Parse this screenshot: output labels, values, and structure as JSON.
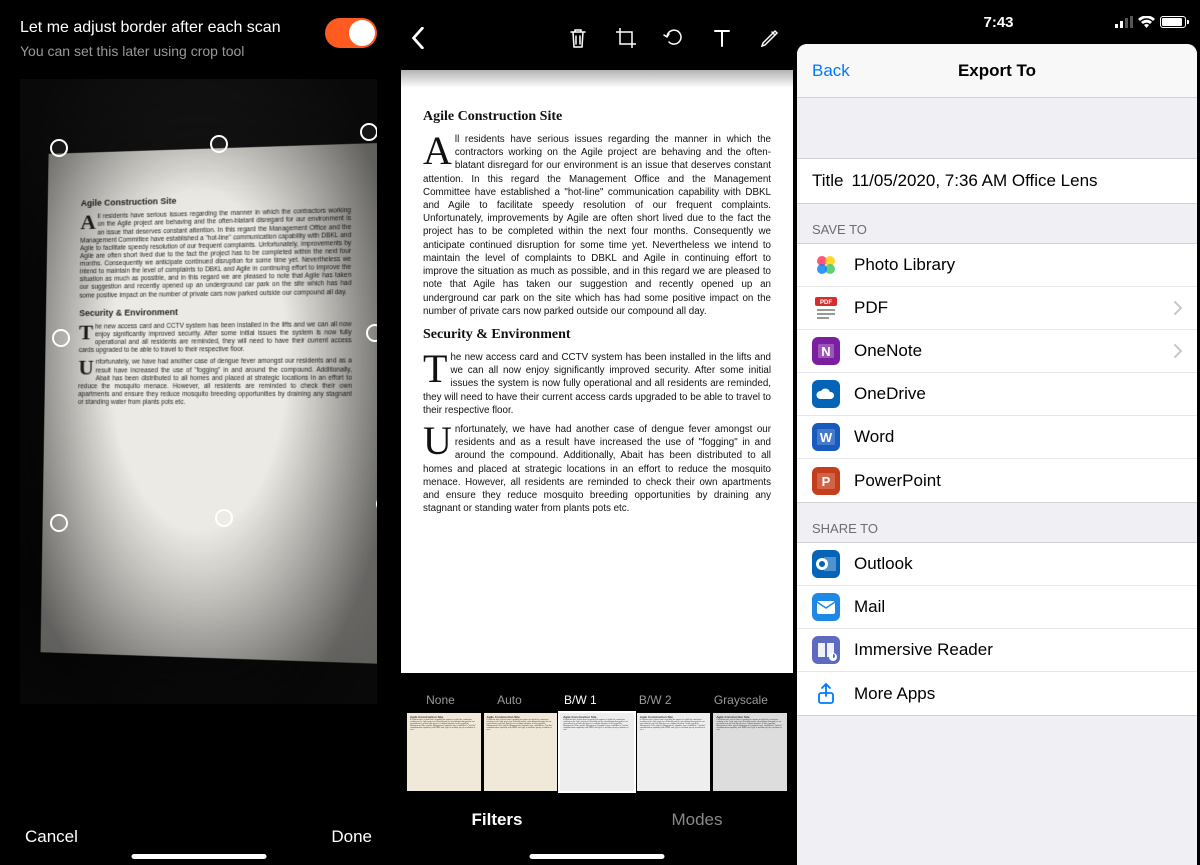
{
  "status_bar": {
    "time": "7:43"
  },
  "panel1": {
    "title": "Let me adjust border after each scan",
    "subtitle": "You can set this later using crop tool",
    "toggle_on": true,
    "cancel": "Cancel",
    "done": "Done"
  },
  "document": {
    "h1": "Agile Construction Site",
    "p1_cap": "A",
    "p1": "ll residents have serious issues regarding the manner in which the contractors working on the Agile project are behaving and the often-blatant disregard for our environment is an issue that deserves constant attention. In this regard the Management Office and the Management Committee have established a \"hot-line\" communication capability with DBKL and Agile to facilitate speedy resolution of our frequent complaints. Unfortunately, improvements by Agile are often short lived due to the fact the project has to be completed within the next four months. Consequently we anticipate continued disruption for some time yet. Nevertheless we intend to maintain the level of complaints to DBKL and Agile in continuing effort to improve the situation as much as possible, and in this regard we are pleased to note that Agile has taken our suggestion and recently opened up an underground car park on the site which has had some positive impact on the number of private cars now parked outside our compound all day.",
    "h2": "Security & Environment",
    "p2_cap": "T",
    "p2": "he new access card  and CCTV system has been installed in the lifts and we can all now enjoy significantly improved security. After some initial issues the system is now fully operational and all residents are reminded, they will need to have their current access cards upgraded to be able to travel to their respective floor.",
    "p3_cap": "U",
    "p3": "nfortunately, we have had another case of dengue fever amongst our residents and as a result have increased the use of \"fogging\" in and around the compound. Additionally, Abait has been distributed to all homes and placed at strategic locations in an effort to reduce the mosquito menace. However, all residents are reminded to check their own apartments and ensure they reduce mosquito breeding opportunities by draining any stagnant or standing water from plants pots etc."
  },
  "panel2": {
    "filters": [
      "None",
      "Auto",
      "B/W 1",
      "B/W 2",
      "Grayscale"
    ],
    "selected_filter_index": 2,
    "tabs": {
      "filters": "Filters",
      "modes": "Modes"
    }
  },
  "panel3": {
    "back": "Back",
    "nav_title": "Export To",
    "title_label": "Title",
    "title_value": "11/05/2020, 7:36 AM Office Lens",
    "save_to_header": "SAVE TO",
    "save_to": [
      {
        "label": "Photo Library",
        "icon": "photos",
        "chevron": false
      },
      {
        "label": "PDF",
        "icon": "pdf",
        "chevron": true
      },
      {
        "label": "OneNote",
        "icon": "onenote",
        "chevron": true
      },
      {
        "label": "OneDrive",
        "icon": "onedrive",
        "chevron": false
      },
      {
        "label": "Word",
        "icon": "word",
        "chevron": false
      },
      {
        "label": "PowerPoint",
        "icon": "powerpoint",
        "chevron": false
      }
    ],
    "share_to_header": "SHARE TO",
    "share_to": [
      {
        "label": "Outlook",
        "icon": "outlook"
      },
      {
        "label": "Mail",
        "icon": "mail"
      },
      {
        "label": "Immersive Reader",
        "icon": "reader"
      },
      {
        "label": "More Apps",
        "icon": "more"
      }
    ]
  },
  "icon_colors": {
    "photos": "linear-gradient(135deg,#ff2d55,#ffcc00,#34c759,#007aff)",
    "pdf": "#d32f2f",
    "onenote": "#7b1fa2",
    "onedrive": "#0364b8",
    "word": "#185abd",
    "powerpoint": "#c43e1c",
    "outlook": "#0364b8",
    "mail": "#1e88e5",
    "reader": "#5c6bc0",
    "more": "#007aff"
  }
}
